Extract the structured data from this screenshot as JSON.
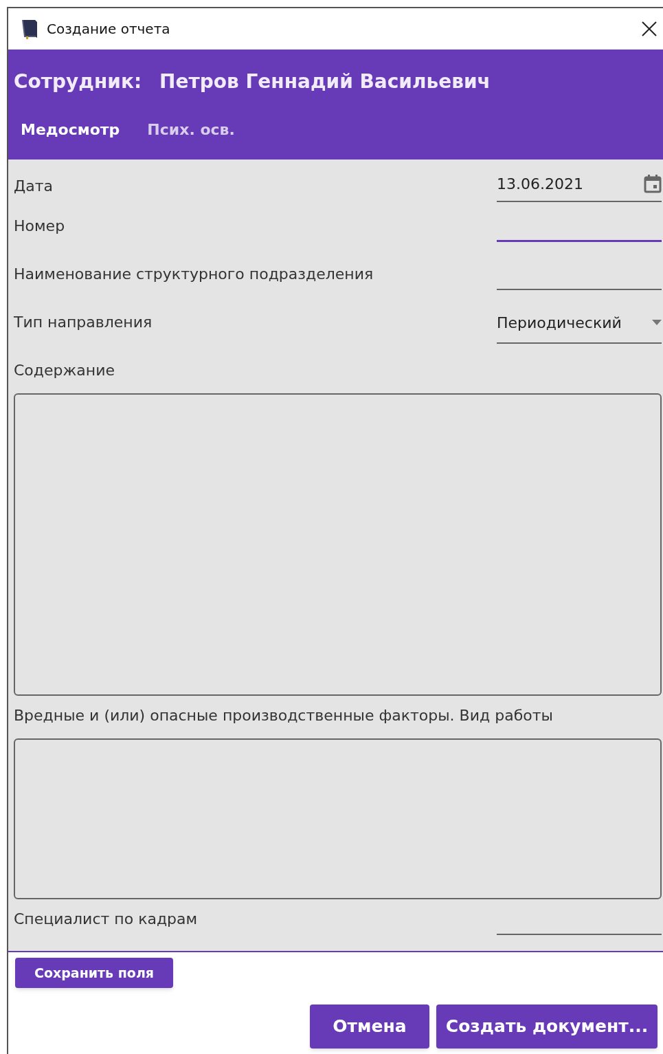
{
  "window": {
    "title": "Создание отчета"
  },
  "header": {
    "label": "Сотрудник:",
    "name": "Петров Геннадий Васильевич"
  },
  "tabs": [
    {
      "label": "Медосмотр",
      "selected": true
    },
    {
      "label": "Псих. осв.",
      "selected": false
    }
  ],
  "fields": [
    {
      "kind": "date",
      "label": "Дата",
      "value": "13.06.2021",
      "focused": false
    },
    {
      "kind": "text",
      "label": "Номер",
      "focused": true
    },
    {
      "kind": "text",
      "label": "Наименование структурного подразделения",
      "focused": false
    },
    {
      "kind": "select",
      "label": "Тип направления",
      "value": "Периодический",
      "focused": false
    },
    {
      "kind": "textarea",
      "label": "Содержание"
    },
    {
      "kind": "textarea",
      "label": "Вредные и (или) опасные производственные факторы. Вид работы"
    },
    {
      "kind": "text",
      "label": "Специалист по кадрам",
      "focused": false
    }
  ],
  "save_button": "Сохранить поля",
  "buttons": [
    "Отмена",
    "Создать документ..."
  ]
}
